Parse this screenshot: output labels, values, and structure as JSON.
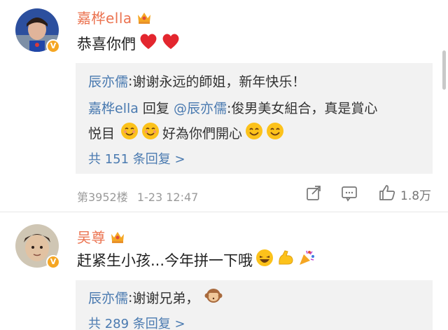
{
  "comments": [
    {
      "author": "嘉桦ella",
      "text": "恭喜你們",
      "badge": "V",
      "replies": [
        {
          "name": "辰亦儒",
          "sep": ":",
          "text": " 谢谢永远的師姐，新年快乐！"
        },
        {
          "name": "嘉桦ella",
          "mid": " 回复 ",
          "mention": "@辰亦儒",
          "text": ":俊男美女組合，真是賞心"
        },
        {
          "cont": "悦目",
          "cont2": "好為你們開心"
        }
      ],
      "more_replies": "共 151 条回复 >",
      "floor": "第3952楼",
      "time": "1-23 12:47",
      "likes": "1.8万"
    },
    {
      "author": "吴尊",
      "text": "赶紧生小孩...今年拼一下哦",
      "badge": "V",
      "replies": [
        {
          "name": "辰亦儒",
          "sep": ":",
          "text": " 谢谢兄弟，"
        }
      ],
      "more_replies": "共 289 条回复 >"
    }
  ],
  "colors": {
    "name": "#eb7350",
    "link": "#4a7ab0",
    "meta": "#9a9a9a",
    "reply_bg": "#f2f2f2",
    "badge": "#f5a623"
  },
  "icons": [
    "crown-icon",
    "heart-icon",
    "share-icon",
    "comment-icon",
    "like-icon",
    "verified-badge-icon",
    "smile-emoji",
    "blush-emoji",
    "grin-emoji",
    "muscle-emoji",
    "party-emoji",
    "monkey-emoji"
  ]
}
